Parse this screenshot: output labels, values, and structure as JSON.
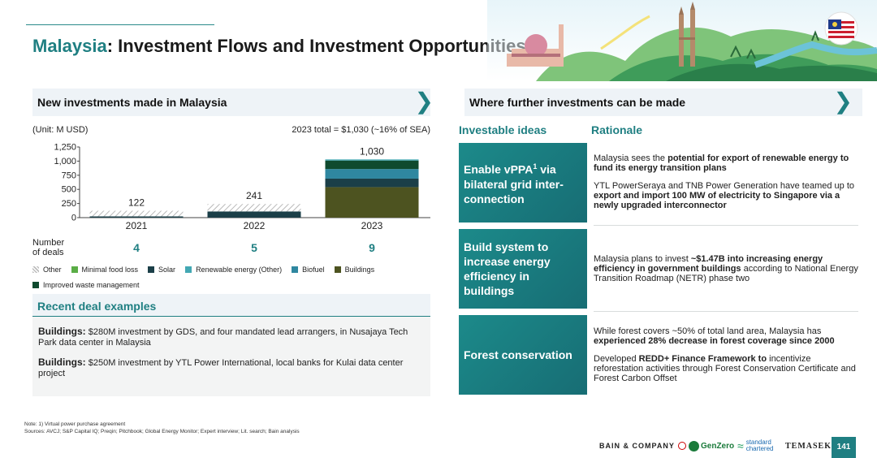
{
  "title": {
    "country": "Malaysia",
    "rest": ": Investment Flows and Investment Opportunities"
  },
  "left_section": {
    "header": "New investments made in Malaysia"
  },
  "right_section": {
    "header": "Where further investments can be made"
  },
  "unit": "(Unit: M USD)",
  "total": "2023 total = $1,030 (~16% of SEA)",
  "deals_label": "Number of deals",
  "deals": [
    "4",
    "5",
    "9"
  ],
  "chart_data": {
    "type": "bar",
    "stacked": true,
    "categories": [
      "2021",
      "2022",
      "2023"
    ],
    "totals": [
      "122",
      "241",
      "1,030"
    ],
    "yticks": [
      0,
      250,
      500,
      750,
      1000,
      1250
    ],
    "ytick_labels": [
      "0",
      "250",
      "500",
      "750",
      "1,000",
      "1,250"
    ],
    "ylim": [
      0,
      1250
    ],
    "series": [
      {
        "name": "Buildings",
        "color": "#4d5320",
        "pattern": "solid",
        "values": [
          0,
          0,
          540
        ]
      },
      {
        "name": "Solar",
        "color": "#1b3f48",
        "pattern": "solid",
        "values": [
          22,
          110,
          150
        ]
      },
      {
        "name": "Biofuel",
        "color": "#2f87a0",
        "pattern": "solid",
        "values": [
          0,
          0,
          170
        ]
      },
      {
        "name": "Improved waste management",
        "color": "#0f4a2e",
        "pattern": "solid",
        "values": [
          0,
          0,
          150
        ]
      },
      {
        "name": "Renewable energy (Other)",
        "color": "#43a8b3",
        "pattern": "solid",
        "values": [
          0,
          0,
          20
        ]
      },
      {
        "name": "Minimal food loss",
        "color": "#5aad46",
        "pattern": "solid",
        "values": [
          0,
          0,
          0
        ]
      },
      {
        "name": "Other",
        "color": "#b9b9b9",
        "pattern": "hatch",
        "values": [
          100,
          131,
          0
        ]
      }
    ]
  },
  "legend": {
    "row1": [
      {
        "name": "Other",
        "color": "#b9b9b9",
        "hatch": true
      },
      {
        "name": "Minimal food loss",
        "color": "#5aad46"
      },
      {
        "name": "Solar",
        "color": "#1b3f48"
      },
      {
        "name": "Renewable energy (Other)",
        "color": "#43a8b3"
      },
      {
        "name": "Biofuel",
        "color": "#2f87a0"
      },
      {
        "name": "Buildings",
        "color": "#4d5320"
      }
    ],
    "row2": [
      {
        "name": "Improved waste management",
        "color": "#0f4a2e"
      }
    ]
  },
  "recent_deals": {
    "header": "Recent deal examples",
    "items": [
      {
        "label": "Buildings:",
        "text": " $280M investment by GDS, and four mandated lead arrangers, in Nusajaya Tech Park data center in Malaysia"
      },
      {
        "label": "Buildings:",
        "text": " $250M investment by YTL Power International, local banks for Kulai data center project"
      }
    ]
  },
  "columns": {
    "ideas": "Investable ideas",
    "rationale": "Rationale"
  },
  "ideas": [
    {
      "title_a": "Enable vPPA",
      "sup": "1",
      "title_b": " via bilateral grid inter-connection",
      "rationale": [
        [
          {
            "t": "Malaysia sees the "
          },
          {
            "t": "potential for export of renewable energy to fund its energy transition plans",
            "b": true
          }
        ],
        [
          {
            "t": "YTL PowerSeraya and TNB Power Generation have teamed up to "
          },
          {
            "t": "export and import 100 MW of electricity to Singapore via a newly upgraded interconnector",
            "b": true
          }
        ]
      ]
    },
    {
      "title_a": "Build system to increase energy efficiency in buildings",
      "sup": "",
      "title_b": "",
      "rationale": [
        [
          {
            "t": "Malaysia plans to invest "
          },
          {
            "t": "~$1.47B into increasing energy efficiency in government buildings",
            "b": true
          },
          {
            "t": " according to National Energy Transition Roadmap (NETR) phase two"
          }
        ]
      ]
    },
    {
      "title_a": "Forest conservation",
      "sup": "",
      "title_b": "",
      "rationale": [
        [
          {
            "t": "While forest covers ~50% of total land area, Malaysia has "
          },
          {
            "t": "experienced 28% decrease in forest coverage since 2000",
            "b": true
          }
        ],
        [
          {
            "t": "Developed "
          },
          {
            "t": "REDD+ Finance Framework to",
            "b": true
          },
          {
            "t": " incentivize reforestation activities through Forest Conservation Certificate and Forest Carbon Offset"
          }
        ]
      ]
    }
  ],
  "notes": [
    "Note: 1) Virtual power purchase agreement",
    "Sources: AVCJ; S&P Capital IQ; Preqin; Pitchbook; Global Energy Monitor; Expert interview; Lit. search; Bain analysis"
  ],
  "logos": {
    "bain": "BAIN & COMPANY",
    "genzero": "GenZero",
    "sc_line1": "standard",
    "sc_line2": "chartered",
    "temasek": "TEMASEK"
  },
  "page_number": "141",
  "colors": {
    "accent": "#1f7f82",
    "idea_box": "#1c8a8a"
  }
}
